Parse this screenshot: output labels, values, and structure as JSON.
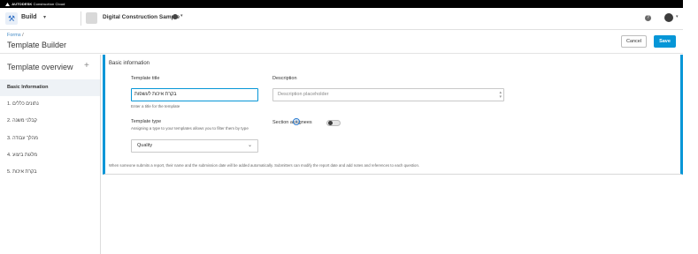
{
  "brand": {
    "name": "AUTODESK",
    "product": "Construction Cloud"
  },
  "topnav": {
    "app_name": "Build",
    "project_name": "Digital Construction Sample"
  },
  "breadcrumb": {
    "parent": "Forms",
    "separator": "/"
  },
  "page": {
    "title": "Template Builder"
  },
  "actions": {
    "cancel_label": "Cancel",
    "save_label": "Save"
  },
  "sidebar": {
    "title": "Template overview",
    "add_symbol": "+",
    "items": [
      {
        "label": "Basic Information",
        "active": true
      },
      {
        "label": "1. נתונים כללים"
      },
      {
        "label": "2. קבלני משנה"
      },
      {
        "label": "3. מהלך עבודה"
      },
      {
        "label": "4. מלגות ביצוע"
      },
      {
        "label": "5. בקרת איכות"
      }
    ]
  },
  "basic_info": {
    "section_title": "Basic information",
    "template_title_label": "Template title",
    "template_title_value": "בקרת איכות לעשפות",
    "template_title_hint": "Enter a title for the template",
    "description_label": "Description",
    "description_placeholder": "Description placeholder",
    "template_type_label": "Template type",
    "template_type_hint": "Assigning a type to your templates allows you to filter them by type",
    "template_type_value": "Quality",
    "section_assignees_label": "Section assignees",
    "section_assignees_enabled": false,
    "footer_note": "When someone submits a report, their name and the submission date will be added automatically. Submitters can modify the report date and add notes and references to each question."
  },
  "colors": {
    "accent": "#0696d7",
    "link": "#3f88c5",
    "annotation": "#2d5fd6"
  }
}
